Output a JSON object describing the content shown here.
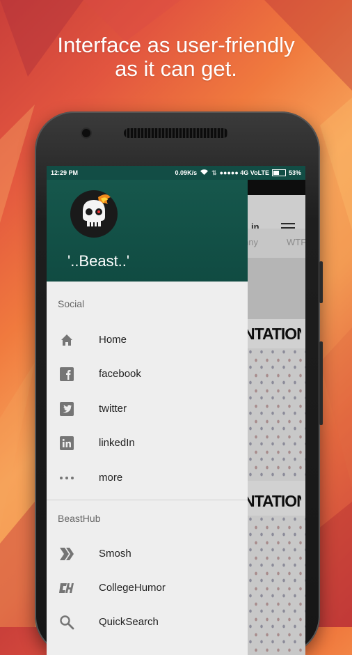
{
  "tagline": {
    "line1": "Interface as user-friendly",
    "line2": "as it can get."
  },
  "statusbar": {
    "time": "12:29 PM",
    "speed": "0.09K/s",
    "network": "●●●●● 4G VoLTE",
    "battery": "53%",
    "battery_level": 0.53
  },
  "drawer": {
    "username": "'..Beast..'",
    "sections": [
      {
        "label": "Social",
        "items": [
          {
            "label": "Home",
            "icon": "home-icon"
          },
          {
            "label": "facebook",
            "icon": "facebook-icon"
          },
          {
            "label": "twitter",
            "icon": "twitter-icon"
          },
          {
            "label": "linkedIn",
            "icon": "linkedin-icon"
          },
          {
            "label": "more",
            "icon": "more-icon"
          }
        ]
      },
      {
        "label": "BeastHub",
        "items": [
          {
            "label": "Smosh",
            "icon": "smosh-icon"
          },
          {
            "label": "CollegeHumor",
            "icon": "collegehumor-icon"
          },
          {
            "label": "QuickSearch",
            "icon": "search-icon"
          }
        ]
      }
    ]
  },
  "background_app": {
    "header_text": "in",
    "tabs": [
      "nny",
      "WTF"
    ],
    "card_titles": [
      "NTATION",
      "NTATION"
    ]
  },
  "colors": {
    "drawer_header": "#16574c",
    "status_bar": "#124d45",
    "drawer_bg": "#eeeeee"
  }
}
